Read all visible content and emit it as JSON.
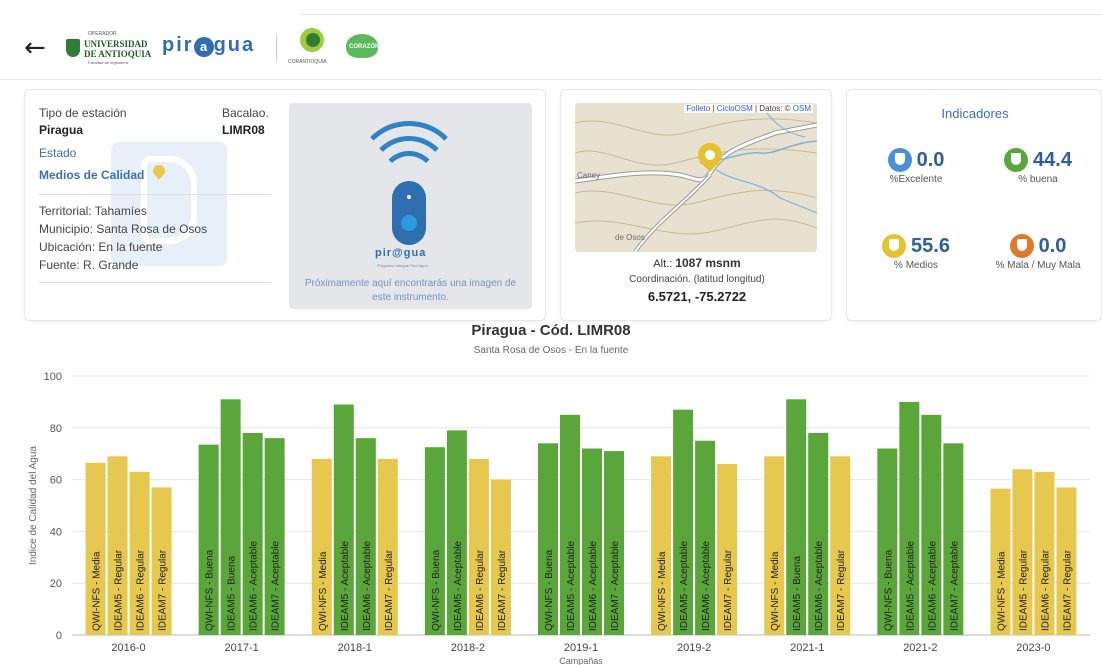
{
  "header": {
    "back_icon": "arrow-left-icon",
    "udea": {
      "op": "OPERADOR",
      "name1": "UNIVERSIDAD",
      "name2": "DE ANTIOQUIA",
      "tag": "Facultad de Ingeniería"
    },
    "piragua": "pir",
    "piragua2": "gua",
    "corantioquia": "CORANTIOQUIA",
    "corazon": "CORAZÓN"
  },
  "station": {
    "type_label": "Tipo de estación",
    "type_value": "Piragua",
    "code_label": "Bacalao.",
    "code_value": "LIMR08",
    "status_label": "Estado",
    "status_value": "Medios de Calidad",
    "territorial": "Territorial: Tahamíes",
    "municipio": "Municipio: Santa Rosa de Osos",
    "ubicacion": "Ubicación: En la fuente",
    "fuente": "Fuente: R. Grande",
    "image_brand": "pir@gua",
    "image_brand_sub": "Programa Integral Red Agua",
    "image_note": "Próximamente aquí encontrarás una imagen de este instrumento."
  },
  "map": {
    "attr_prefix": "",
    "attr_link1": "Folleto",
    "attr_sep1": " | ",
    "attr_link2": "CicloOSM",
    "attr_sep2": " | Datos: © ",
    "attr_link3": "OSM",
    "label_caney": "Caney",
    "label_osos": "de Osos",
    "alt_label": "Alt.:",
    "alt_value": "1087 msnm",
    "coord_label": "Coordinación. (latitud longitud)",
    "coord_value": "6.5721, -75.2722"
  },
  "indicators": {
    "title": "Indicadores",
    "items": [
      {
        "value": "0.0",
        "label": "%Excelente",
        "color": "#4a90d9"
      },
      {
        "value": "44.4",
        "label": "% buena",
        "color": "#5aa63a"
      },
      {
        "value": "55.6",
        "label": "% Medios",
        "color": "#e8c130"
      },
      {
        "value": "0.0",
        "label": "% Mala / Muy Mala",
        "color": "#e07a28"
      }
    ]
  },
  "chart": {
    "title": "Piragua - Cód. LIMR08",
    "subtitle": "Santa Rosa de Osos - En la fuente"
  },
  "chart_data": {
    "type": "bar",
    "title": "Piragua - Cód. LIMR08",
    "subtitle": "Santa Rosa de Osos - En la fuente",
    "xlabel": "Campañas",
    "ylabel": "Indice de Calidad del Agua",
    "ylim": [
      0,
      100
    ],
    "yticks": [
      0,
      20,
      40,
      60,
      80,
      100
    ],
    "grid": true,
    "colors": {
      "Media": "#e6c84f",
      "Regular": "#e6c84f",
      "Buena": "#5aa63a",
      "Aceptable": "#5aa63a"
    },
    "groups": [
      {
        "campaign": "2016-0",
        "bars": [
          {
            "label": "QWI-NFS - Media",
            "value": 66.5,
            "class": "Media"
          },
          {
            "label": "IDEAM5 - Regular",
            "value": 69,
            "class": "Regular"
          },
          {
            "label": "IDEAM6 - Regular",
            "value": 63,
            "class": "Regular"
          },
          {
            "label": "IDEAM7 - Regular",
            "value": 57,
            "class": "Regular"
          }
        ]
      },
      {
        "campaign": "2017-1",
        "bars": [
          {
            "label": "QWI-NFS - Buena",
            "value": 73.5,
            "class": "Buena"
          },
          {
            "label": "IDEAM5 - Buena",
            "value": 91,
            "class": "Buena"
          },
          {
            "label": "IDEAM6 - Aceptable",
            "value": 78,
            "class": "Aceptable"
          },
          {
            "label": "IDEAM7 - Aceptable",
            "value": 76,
            "class": "Aceptable"
          }
        ]
      },
      {
        "campaign": "2018-1",
        "bars": [
          {
            "label": "QWI-NFS - Media",
            "value": 68,
            "class": "Media"
          },
          {
            "label": "IDEAM5 - Aceptable",
            "value": 89,
            "class": "Aceptable"
          },
          {
            "label": "IDEAM6 - Aceptable",
            "value": 76,
            "class": "Aceptable"
          },
          {
            "label": "IDEAM7 - Regular",
            "value": 68,
            "class": "Regular"
          }
        ]
      },
      {
        "campaign": "2018-2",
        "bars": [
          {
            "label": "QWI-NFS - Buena",
            "value": 72.5,
            "class": "Buena"
          },
          {
            "label": "IDEAM5 - Aceptable",
            "value": 79,
            "class": "Aceptable"
          },
          {
            "label": "IDEAM6 - Regular",
            "value": 68,
            "class": "Regular"
          },
          {
            "label": "IDEAM7 - Regular",
            "value": 60,
            "class": "Regular"
          }
        ]
      },
      {
        "campaign": "2019-1",
        "bars": [
          {
            "label": "QWI-NFS - Buena",
            "value": 74,
            "class": "Buena"
          },
          {
            "label": "IDEAM5 - Aceptable",
            "value": 85,
            "class": "Aceptable"
          },
          {
            "label": "IDEAM6 - Aceptable",
            "value": 72,
            "class": "Aceptable"
          },
          {
            "label": "IDEAM7 - Aceptable",
            "value": 71,
            "class": "Aceptable"
          }
        ]
      },
      {
        "campaign": "2019-2",
        "bars": [
          {
            "label": "QWI-NFS - Media",
            "value": 69,
            "class": "Media"
          },
          {
            "label": "IDEAM5 - Aceptable",
            "value": 87,
            "class": "Aceptable"
          },
          {
            "label": "IDEAM6 - Aceptable",
            "value": 75,
            "class": "Aceptable"
          },
          {
            "label": "IDEAM7 - Regular",
            "value": 66,
            "class": "Regular"
          }
        ]
      },
      {
        "campaign": "2021-1",
        "bars": [
          {
            "label": "QWI-NFS - Media",
            "value": 69,
            "class": "Media"
          },
          {
            "label": "IDEAM5 - Buena",
            "value": 91,
            "class": "Buena"
          },
          {
            "label": "IDEAM6 - Aceptable",
            "value": 78,
            "class": "Aceptable"
          },
          {
            "label": "IDEAM7 - Regular",
            "value": 69,
            "class": "Regular"
          }
        ]
      },
      {
        "campaign": "2021-2",
        "bars": [
          {
            "label": "QWI-NFS - Buena",
            "value": 72,
            "class": "Buena"
          },
          {
            "label": "IDEAM5 - Aceptable",
            "value": 90,
            "class": "Aceptable"
          },
          {
            "label": "IDEAM6 - Aceptable",
            "value": 85,
            "class": "Aceptable"
          },
          {
            "label": "IDEAM7 - Aceptable",
            "value": 74,
            "class": "Aceptable"
          }
        ]
      },
      {
        "campaign": "2023-0",
        "bars": [
          {
            "label": "QWI-NFS - Media",
            "value": 56.5,
            "class": "Media"
          },
          {
            "label": "IDEAM5 - Regular",
            "value": 64,
            "class": "Regular"
          },
          {
            "label": "IDEAM6 - Regular",
            "value": 63,
            "class": "Regular"
          },
          {
            "label": "IDEAM7 - Regular",
            "value": 57,
            "class": "Regular"
          }
        ]
      }
    ]
  }
}
